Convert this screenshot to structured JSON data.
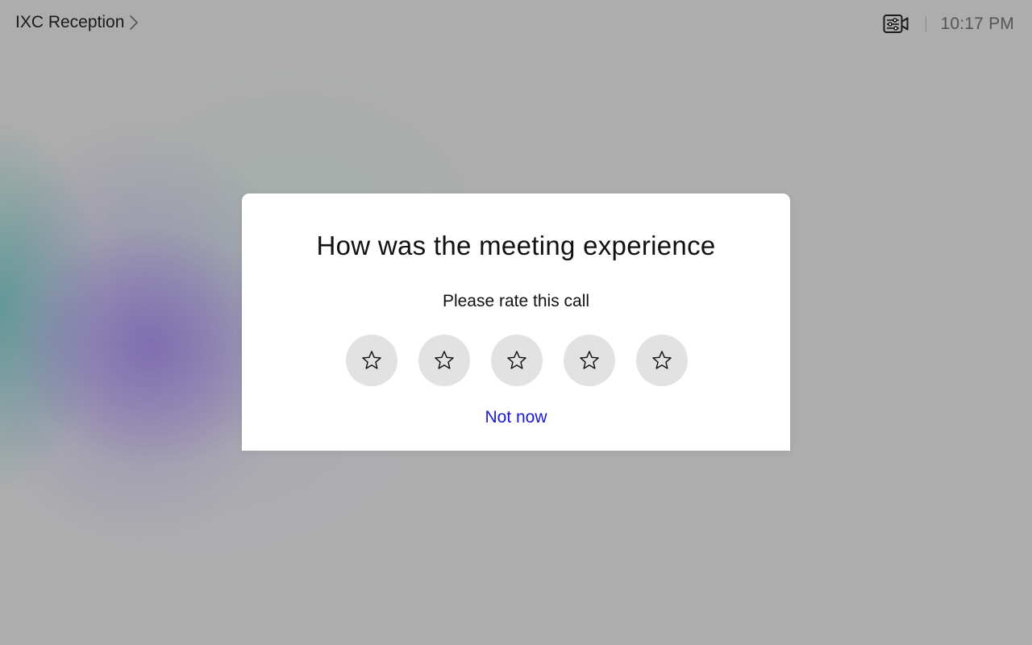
{
  "header": {
    "room_name": "IXC Reception",
    "clock": "10:17 PM",
    "icons": {
      "room_chevron": "chevron-right-icon",
      "camera_controls": "camera-controls-icon"
    }
  },
  "dialog": {
    "title": "How was the meeting experience",
    "subtitle": "Please rate this call",
    "rating": {
      "max": 5,
      "selected": 0,
      "star_icon": "star-outline-icon",
      "stars": [
        {
          "value": 1
        },
        {
          "value": 2
        },
        {
          "value": 3
        },
        {
          "value": 4
        },
        {
          "value": 5
        }
      ]
    },
    "dismiss_label": "Not now"
  },
  "colors": {
    "background": "#adadad",
    "dialog_background": "#ffffff",
    "star_button": "#e2e2e2",
    "link": "#1a1ad6",
    "text": "#111111",
    "clock": "#555555"
  }
}
